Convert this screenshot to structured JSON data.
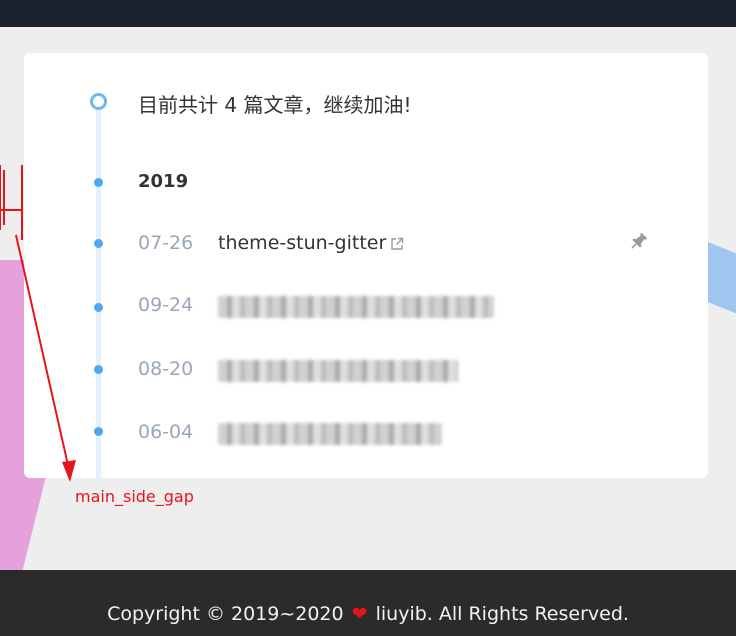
{
  "archive": {
    "summary": "目前共计 4 篇文章，继续加油!",
    "year": "2019",
    "posts": [
      {
        "date": "07-26",
        "title": "theme-stun-gitter",
        "external": true,
        "pinned": true,
        "pin_icon": "pin-icon",
        "external_icon": "external-link-icon"
      },
      {
        "date": "09-24",
        "title": "",
        "blurred": true
      },
      {
        "date": "08-20",
        "title": "",
        "blurred": true
      },
      {
        "date": "06-04",
        "title": "",
        "blurred": true
      }
    ]
  },
  "annotation": {
    "label": "main_side_gap",
    "color": "#e8141c"
  },
  "footer": {
    "copyright_prefix": "Copyright © 2019~2020",
    "heart": "❤",
    "copyright_suffix": "liuyib. All Rights Reserved."
  },
  "colors": {
    "accent": "#4ea8f0",
    "timeline_track": "#e3f0fd",
    "date_text": "#9aa7b5",
    "footer_bg": "#2b2b2b",
    "topbar_bg": "#1c2230"
  }
}
